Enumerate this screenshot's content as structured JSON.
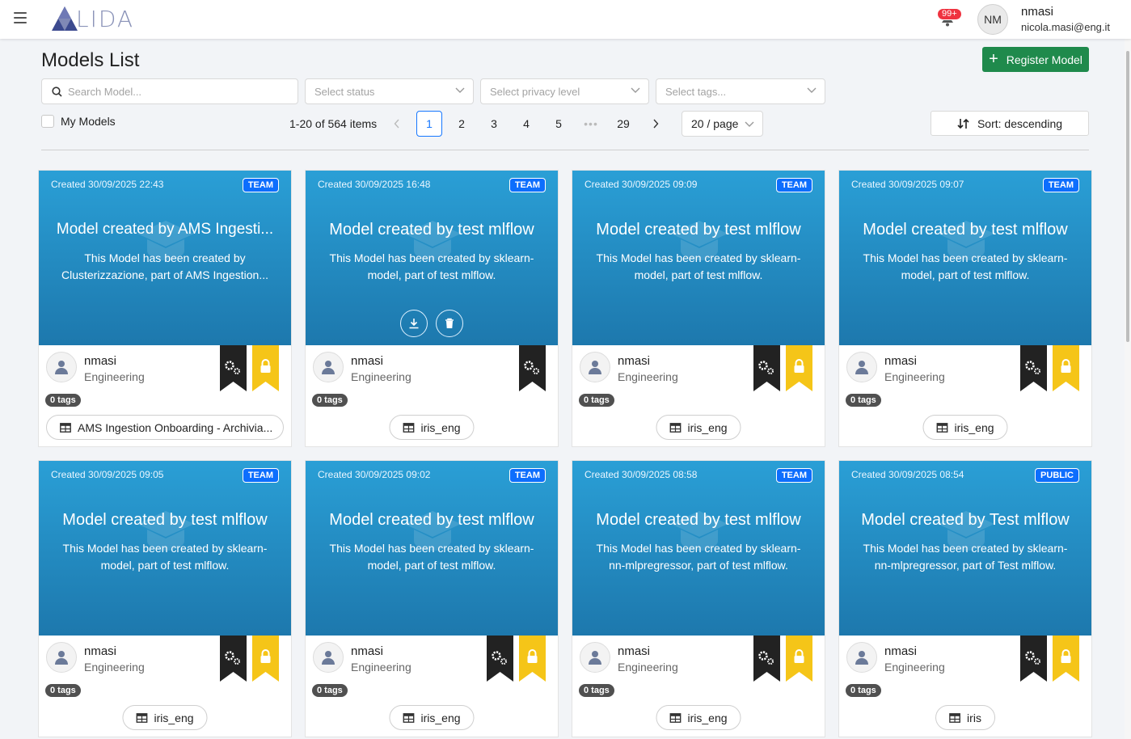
{
  "app": {
    "logo_text": "LIDA",
    "notifications_badge": "99+"
  },
  "user": {
    "initials": "NM",
    "name": "nmasi",
    "email": "nicola.masi@eng.it"
  },
  "page": {
    "title": "Models List",
    "register_label": "Register Model"
  },
  "filters": {
    "search_placeholder": "Search Model...",
    "status_placeholder": "Select status",
    "privacy_placeholder": "Select privacy level",
    "tags_placeholder": "Select tags...",
    "my_models_label": "My Models",
    "my_models_checked": false
  },
  "pagination": {
    "info": "1-20 of 564 items",
    "pages": [
      "1",
      "2",
      "3",
      "4",
      "5"
    ],
    "ellipsis": "•••",
    "last": "29",
    "current": "1",
    "page_size": "20 / page"
  },
  "sort": {
    "label": "Sort: descending"
  },
  "colors": {
    "accent": "#1677ff",
    "register": "#1f8a4c",
    "card_top": "#2a9fd6",
    "card_bottom": "#1d78ad",
    "team_badge": "#0d6efd",
    "ribbon_dark": "#222222",
    "ribbon_gold": "#f5c518",
    "notif_badge": "#ef3340"
  },
  "cards": [
    {
      "created": "Created 30/09/2025 22:43",
      "privacy": "TEAM",
      "title": "Model created by AMS Ingesti...",
      "desc": "This Model has been created by Clusterizzazione, part of AMS Ingestion...",
      "owner": "nmasi",
      "org": "Engineering",
      "tags": "0 tags",
      "dataset": "AMS Ingestion Onboarding - Archivia...",
      "locked": true,
      "actions": false
    },
    {
      "created": "Created 30/09/2025 16:48",
      "privacy": "TEAM",
      "title": "Model created by test mlflow",
      "desc": "This Model has been created by sklearn-model, part of test mlflow.",
      "owner": "nmasi",
      "org": "Engineering",
      "tags": "0 tags",
      "dataset": "iris_eng",
      "locked": false,
      "actions": true
    },
    {
      "created": "Created 30/09/2025 09:09",
      "privacy": "TEAM",
      "title": "Model created by test mlflow",
      "desc": "This Model has been created by sklearn-model, part of test mlflow.",
      "owner": "nmasi",
      "org": "Engineering",
      "tags": "0 tags",
      "dataset": "iris_eng",
      "locked": true,
      "actions": false
    },
    {
      "created": "Created 30/09/2025 09:07",
      "privacy": "TEAM",
      "title": "Model created by test mlflow",
      "desc": "This Model has been created by sklearn-model, part of test mlflow.",
      "owner": "nmasi",
      "org": "Engineering",
      "tags": "0 tags",
      "dataset": "iris_eng",
      "locked": true,
      "actions": false
    },
    {
      "created": "Created 30/09/2025 09:05",
      "privacy": "TEAM",
      "title": "Model created by test mlflow",
      "desc": "This Model has been created by sklearn-model, part of test mlflow.",
      "owner": "nmasi",
      "org": "Engineering",
      "tags": "0 tags",
      "dataset": "iris_eng",
      "locked": true,
      "actions": false
    },
    {
      "created": "Created 30/09/2025 09:02",
      "privacy": "TEAM",
      "title": "Model created by test mlflow",
      "desc": "This Model has been created by sklearn-model, part of test mlflow.",
      "owner": "nmasi",
      "org": "Engineering",
      "tags": "0 tags",
      "dataset": "iris_eng",
      "locked": true,
      "actions": false
    },
    {
      "created": "Created 30/09/2025 08:58",
      "privacy": "TEAM",
      "title": "Model created by test mlflow",
      "desc": "This Model has been created by sklearn-nn-mlpregressor, part of test mlflow.",
      "owner": "nmasi",
      "org": "Engineering",
      "tags": "0 tags",
      "dataset": "iris_eng",
      "locked": true,
      "actions": false
    },
    {
      "created": "Created 30/09/2025 08:54",
      "privacy": "PUBLIC",
      "title": "Model created by Test mlflow",
      "desc": "This Model has been created by sklearn-nn-mlpregressor, part of Test mlflow.",
      "owner": "nmasi",
      "org": "Engineering",
      "tags": "0 tags",
      "dataset": "iris",
      "locked": true,
      "actions": false
    }
  ]
}
